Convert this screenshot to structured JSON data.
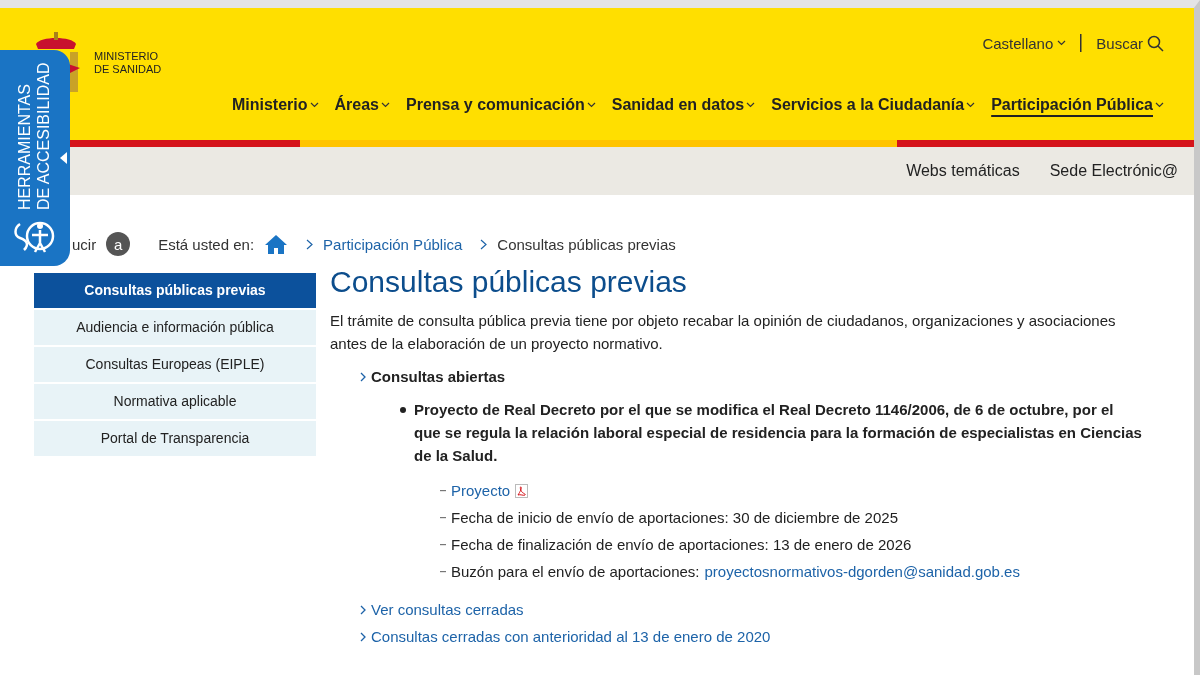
{
  "header": {
    "logo": [
      "MINISTERIO",
      "DE SANIDAD"
    ],
    "language": "Castellano",
    "search": "Buscar",
    "nav": [
      {
        "label": "Ministerio",
        "selected": false
      },
      {
        "label": "Áreas",
        "selected": false
      },
      {
        "label": "Prensa y comunicación",
        "selected": false
      },
      {
        "label": "Sanidad en datos",
        "selected": false
      },
      {
        "label": "Servicios a la Ciudadanía",
        "selected": false
      },
      {
        "label": "Participación Pública",
        "selected": true
      }
    ]
  },
  "subnav": [
    "Webs temáticas",
    "Sede Electrónic@"
  ],
  "accessibility_tab": {
    "label": "HERRAMIENTAS DE ACCESIBILIDAD",
    "expanded": false
  },
  "reader": {
    "label": "ucir",
    "badge": "a"
  },
  "breadcrumb": {
    "label": "Está usted en:",
    "items": [
      "Participación Pública",
      "Consultas públicas previas"
    ]
  },
  "sidebar": [
    {
      "label": "Consultas públicas previas",
      "selected": true
    },
    {
      "label": "Audiencia e información pública",
      "selected": false
    },
    {
      "label": "Consultas Europeas (EIPLE)",
      "selected": false
    },
    {
      "label": "Normativa aplicable",
      "selected": false
    },
    {
      "label": "Portal de Transparencia",
      "selected": false
    }
  ],
  "main": {
    "title": "Consultas públicas previas",
    "intro": "El trámite de consulta pública previa tiene por objeto recabar la opinión de ciudadanos, organizaciones y asociaciones antes de la elaboración de un proyecto normativo.",
    "open_heading": "Consultas abiertas",
    "project": "Proyecto de Real Decreto por el que se modifica el Real Decreto 1146/2006, de 6 de octubre, por el que se regula la relación laboral especial de residencia para la formación de especialistas en Ciencias de la Salud.",
    "details": [
      {
        "kind": "link",
        "text": "Proyecto"
      },
      {
        "kind": "text",
        "text": "Fecha de inicio de envío de aportaciones: 30 de diciembre de 2025"
      },
      {
        "kind": "text",
        "text": "Fecha de finalización de envío de aportaciones: 13 de enero de 2026"
      },
      {
        "kind": "email",
        "text": "Buzón para el envío de aportaciones:",
        "link": "proyectosnormativos-dgorden@sanidad.gob.es"
      }
    ],
    "links": [
      "Ver consultas cerradas",
      "Consultas cerradas con anterioridad al 13 de enero de 2020"
    ]
  }
}
